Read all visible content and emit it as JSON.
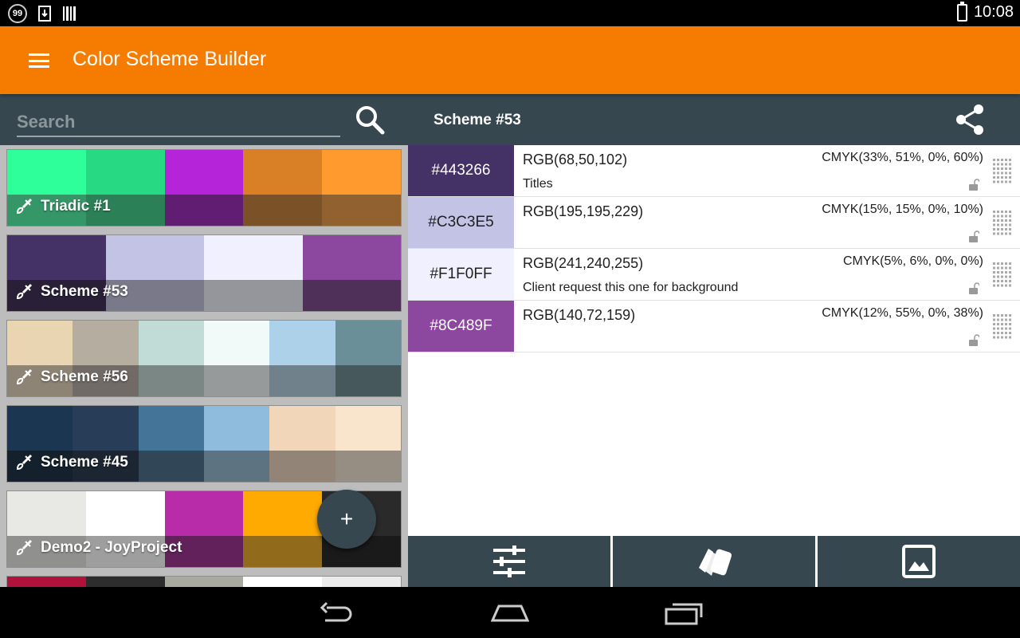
{
  "status_bar": {
    "badge": "99",
    "time": "10:08"
  },
  "app_bar": {
    "title": "Color Scheme Builder"
  },
  "search": {
    "placeholder": "Search"
  },
  "schemes": [
    {
      "name": "Triadic #1",
      "colors": [
        "#2EFF9B",
        "#26D982",
        "#B624D9",
        "#D97F26",
        "#FF9A2E"
      ]
    },
    {
      "name": "Scheme #53",
      "colors": [
        "#443266",
        "#C3C3E5",
        "#F1F0FF",
        "#8C489F"
      ]
    },
    {
      "name": "Scheme #56",
      "colors": [
        "#EAD5B3",
        "#B6ADA1",
        "#C1DBD7",
        "#F1F9F9",
        "#ADD1E8",
        "#6B8F99"
      ]
    },
    {
      "name": "Scheme #45",
      "colors": [
        "#1B3650",
        "#283D57",
        "#457499",
        "#8FBBDC",
        "#F2D6BA",
        "#F8E5CC"
      ]
    },
    {
      "name": "Demo2 - JoyProject",
      "colors": [
        "#E8E8E4",
        "#FFFFFF",
        "#B82BA9",
        "#FFAA00",
        "#2A2A2A"
      ]
    },
    {
      "name": "",
      "colors": [
        "#B0123C",
        "#2D2D2D",
        "#A8AAA0",
        "#FFFFFF",
        "#EBEBEB"
      ]
    }
  ],
  "detail": {
    "title": "Scheme #53",
    "colors": [
      {
        "hex": "#443266",
        "rgb": "RGB(68,50,102)",
        "cmyk": "CMYK(33%, 51%, 0%, 60%)",
        "note": "Titles",
        "text_color": "#FFFFFF"
      },
      {
        "hex": "#C3C3E5",
        "rgb": "RGB(195,195,229)",
        "cmyk": "CMYK(15%, 15%, 0%, 10%)",
        "note": "",
        "text_color": "#212121"
      },
      {
        "hex": "#F1F0FF",
        "rgb": "RGB(241,240,255)",
        "cmyk": "CMYK(5%, 6%, 0%, 0%)",
        "note": "Client request this one for background",
        "text_color": "#212121"
      },
      {
        "hex": "#8C489F",
        "rgb": "RGB(140,72,159)",
        "cmyk": "CMYK(12%, 55%, 0%, 38%)",
        "note": "",
        "text_color": "#FFFFFF"
      }
    ]
  },
  "fab": {
    "label": "+"
  },
  "colors": {
    "app_bar": "#F57C00",
    "panel": "#37474F"
  }
}
